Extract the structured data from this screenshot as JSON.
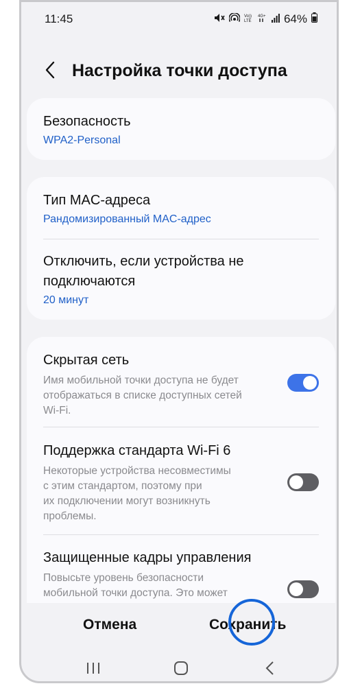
{
  "status_bar": {
    "time": "11:45",
    "battery": "64%"
  },
  "header": {
    "title": "Настройка точки доступа"
  },
  "security": {
    "title": "Безопасность",
    "value": "WPA2-Personal"
  },
  "mac": {
    "title": "Тип MAC-адреса",
    "value": "Рандомизированный MAC-адрес"
  },
  "timeout": {
    "title_line1": "Отключить, если устройства не",
    "title_line2": "подключаются",
    "value": "20 минут"
  },
  "hidden_network": {
    "title": "Скрытая сеть",
    "desc_line1": "Имя мобильной точки доступа не будет",
    "desc_line2": "отображаться в списке доступных сетей",
    "desc_line3": "Wi-Fi.",
    "enabled": true
  },
  "wifi6": {
    "title": "Поддержка стандарта Wi-Fi 6",
    "desc_line1": "Некоторые устройства несовместимы",
    "desc_line2": "с этим стандартом, поэтому при",
    "desc_line3": "их подключении могут возникнуть",
    "desc_line4": "проблемы.",
    "enabled": false
  },
  "pmf": {
    "title": "Защищенные кадры управления",
    "desc_line1": "Повысьте уровень безопасности",
    "desc_line2": "мобильной точки доступа. Это может",
    "enabled": false
  },
  "actions": {
    "cancel": "Отмена",
    "save": "Сохранить"
  },
  "colors": {
    "accent": "#3d73e8",
    "link": "#2060c8",
    "highlight": "#1565d8"
  }
}
